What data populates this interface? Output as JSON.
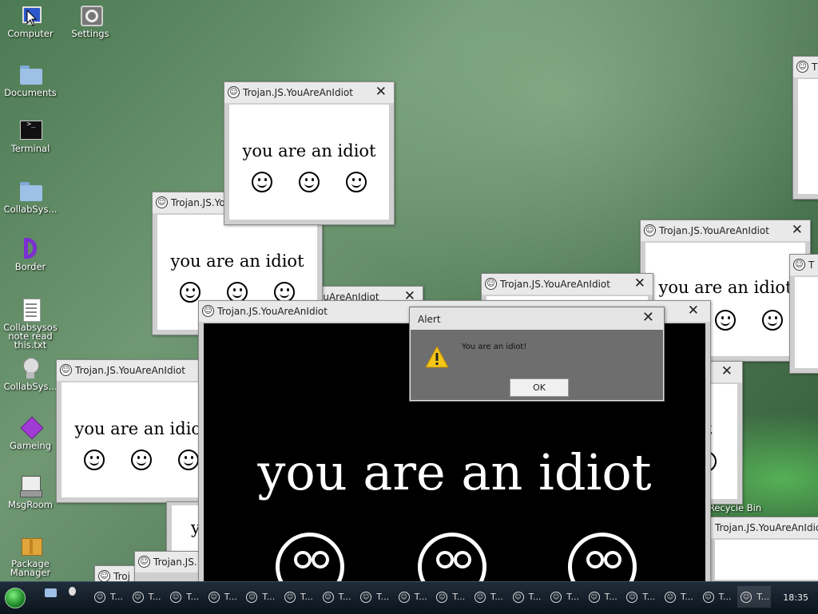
{
  "desktop": {
    "icons": [
      {
        "name": "monitor-icon",
        "label": "Computer"
      },
      {
        "name": "settings-icon",
        "label": "Settings"
      },
      {
        "name": "folder-icon",
        "label": "Documents"
      },
      {
        "name": "terminal-icon",
        "label": "Terminal"
      },
      {
        "name": "folder-icon",
        "label": "CollabSys..."
      },
      {
        "name": "border-icon",
        "label": "Border"
      },
      {
        "name": "text-file-icon",
        "label": "Collabsysos note read this.txt"
      },
      {
        "name": "collabsys-icon",
        "label": "CollabSys..."
      },
      {
        "name": "cube-icon",
        "label": "Gameing"
      },
      {
        "name": "msgroom-icon",
        "label": "MsgRoom"
      },
      {
        "name": "package-icon",
        "label": "Package Manager"
      },
      {
        "name": "recycle-bin-icon",
        "label": "Recycle Bin"
      }
    ]
  },
  "popup": {
    "title": "Trojan.JS.YouAreAnIdiot",
    "title_short": "Trojan.JS.You",
    "title_shorter": "Trojan.JS.",
    "title_tiny": "Troj",
    "title_fragment": "ouAreAnIdiot",
    "title_edge": "T",
    "message": "you are an idiot",
    "message_fragment_t": "t",
    "message_fragment_y": "y"
  },
  "alert": {
    "title": "Alert",
    "message": "You are an idiot!",
    "ok_label": "OK",
    "icon": "warning-icon"
  },
  "taskbar": {
    "task_label": "T...",
    "task_count": 18,
    "clock": "18:35",
    "colors": {
      "bar": "#0f1923"
    }
  }
}
